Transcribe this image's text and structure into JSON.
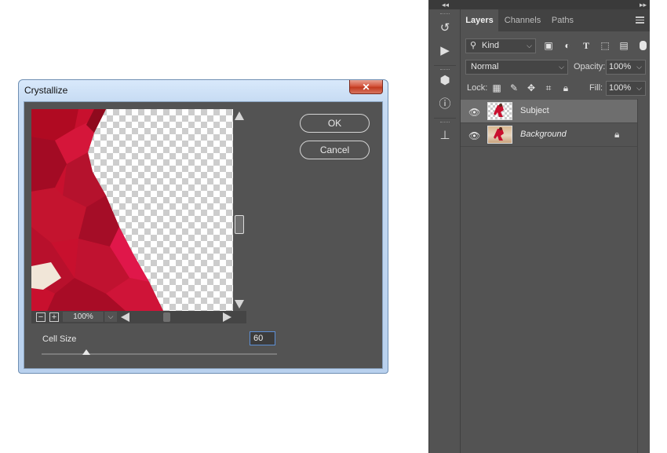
{
  "dialog": {
    "title": "Crystallize",
    "close_glyph": "✕",
    "ok_label": "OK",
    "cancel_label": "Cancel",
    "zoom_minus": "−",
    "zoom_plus": "+",
    "zoom_value": "100%",
    "cell_size_label": "Cell Size",
    "cell_size_value": "60",
    "cell_size_slider_fraction": 0.19
  },
  "toolstrip": {
    "collapse_glyph": "◂◂",
    "tools": [
      {
        "name": "history-icon",
        "glyph": "↺"
      },
      {
        "name": "actions-play-icon",
        "glyph": "▶"
      },
      {
        "name": "3d-cube-icon",
        "glyph": "⬢"
      },
      {
        "name": "info-icon",
        "glyph": "ⓘ"
      },
      {
        "name": "clone-source-icon",
        "glyph": "⊥"
      }
    ]
  },
  "layers_panel": {
    "expand_glyph": "▸▸",
    "tabs": [
      "Layers",
      "Channels",
      "Paths"
    ],
    "active_tab": "Layers",
    "filter_kind": "Kind",
    "blend_mode": "Normal",
    "opacity_label": "Opacity:",
    "opacity_value": "100%",
    "lock_label": "Lock:",
    "fill_label": "Fill:",
    "fill_value": "100%",
    "layers": [
      {
        "name": "Subject",
        "selected": true,
        "locked": false
      },
      {
        "name": "Background",
        "selected": false,
        "locked": true
      }
    ]
  },
  "colors": {
    "ps_panel_bg": "#535353",
    "accent_red": "#c8102e",
    "selection_blue": "#5d8fd6"
  }
}
